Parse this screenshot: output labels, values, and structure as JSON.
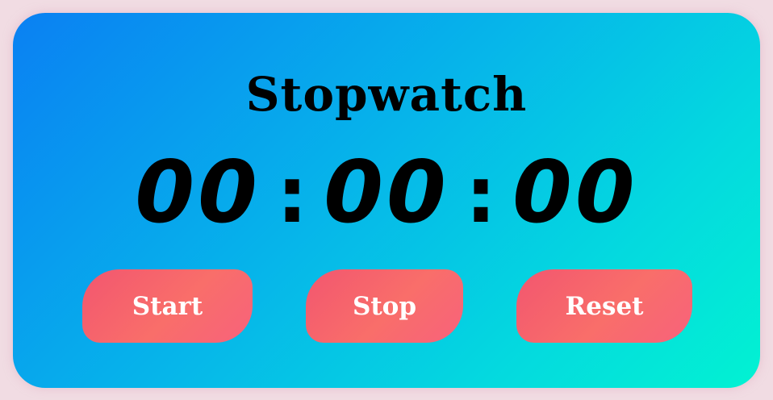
{
  "app": {
    "title": "Stopwatch"
  },
  "timer": {
    "hours": "00",
    "minutes": "00",
    "seconds": "00",
    "separator": ":"
  },
  "controls": {
    "start_label": "Start",
    "stop_label": "Stop",
    "reset_label": "Reset"
  },
  "colors": {
    "page_background": "#f1dce3",
    "card_gradient_start": "#0a80f3",
    "card_gradient_end": "#02f2d2",
    "button_gradient_start": "#f2566f",
    "button_gradient_end": "#f96e6a",
    "button_text": "#ffffff",
    "text": "#000000"
  }
}
